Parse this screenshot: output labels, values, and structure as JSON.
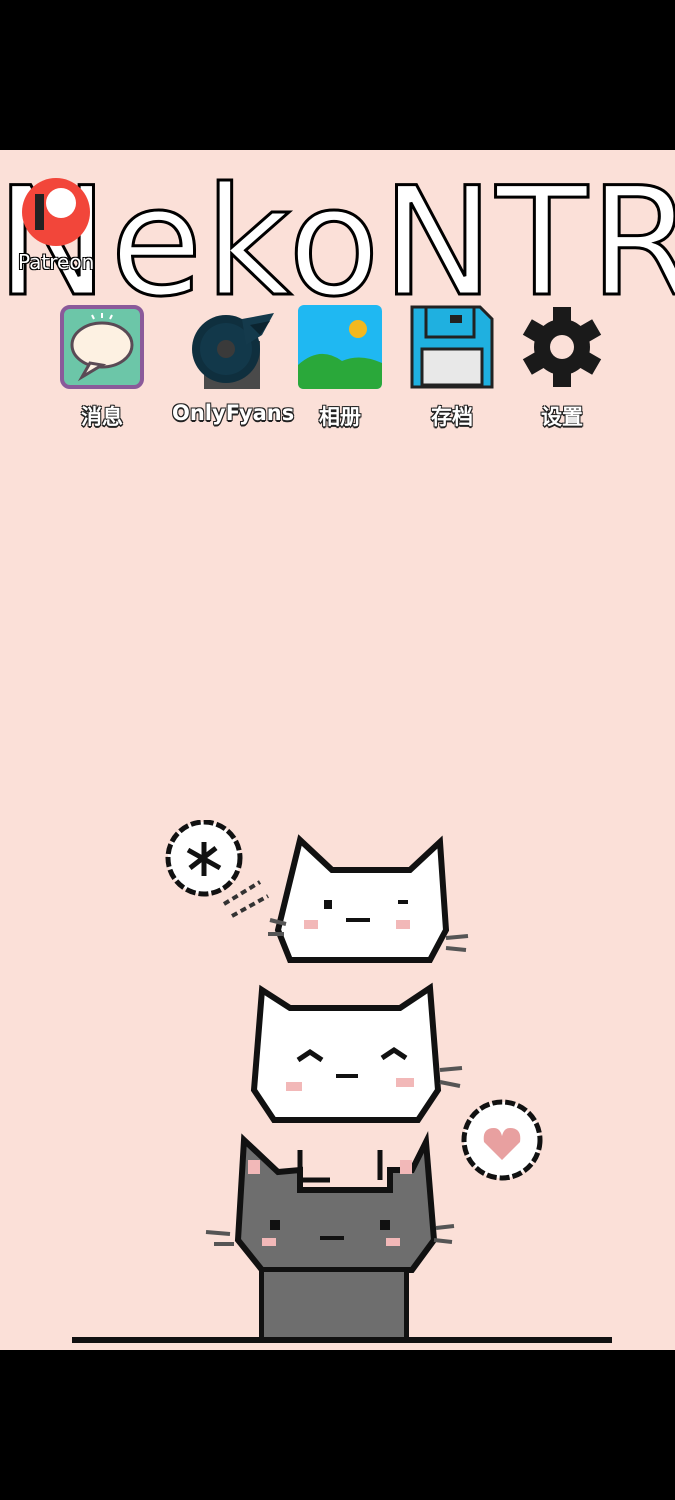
{
  "game": {
    "title": "NekoNTR"
  },
  "patreon": {
    "label": "Patreon",
    "icon": "patreon-logo-icon",
    "color": "#f2463a"
  },
  "apps": [
    {
      "label": "消息",
      "icon": "chat-bubble-icon"
    },
    {
      "label": "OnlyFyans",
      "icon": "onlyfyans-logo-icon"
    },
    {
      "label": "相册",
      "icon": "gallery-icon"
    },
    {
      "label": "存档",
      "icon": "floppy-disk-icon"
    },
    {
      "label": "设置",
      "icon": "gear-icon"
    }
  ],
  "colors": {
    "background": "#fbe0d8",
    "letterbox": "#000000"
  }
}
